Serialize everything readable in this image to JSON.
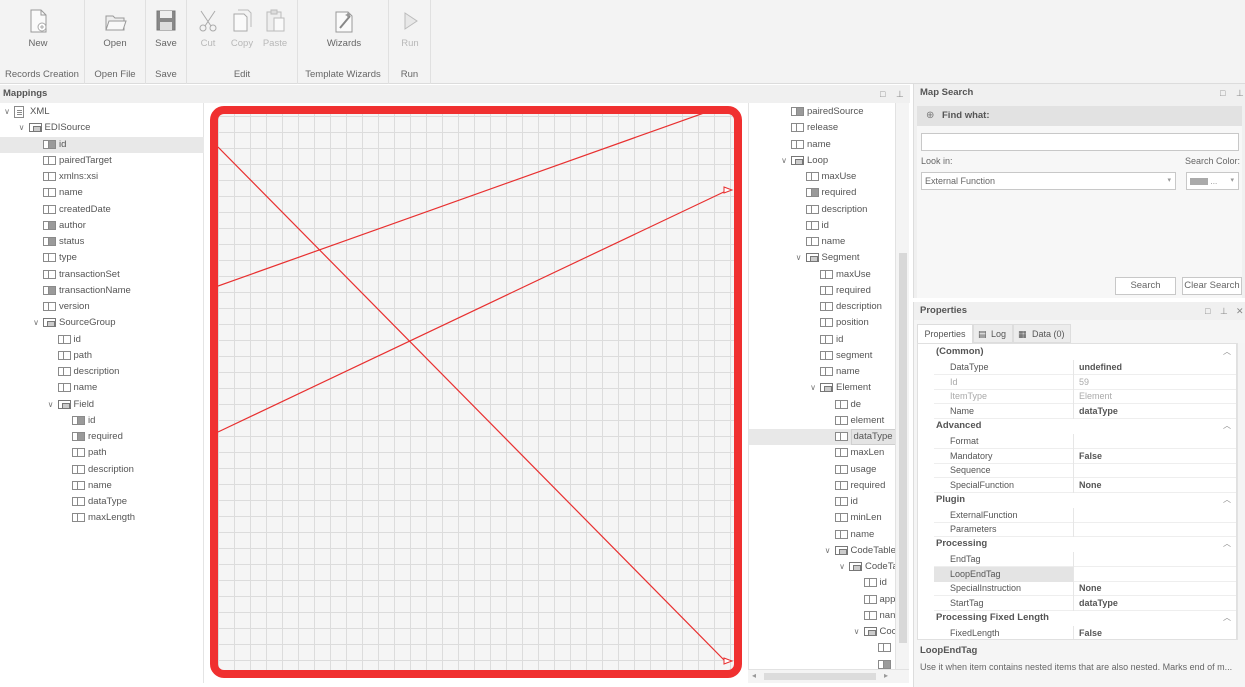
{
  "ribbon": {
    "new": "New",
    "open": "Open",
    "save": "Save",
    "cut": "Cut",
    "copy": "Copy",
    "paste": "Paste",
    "wizards": "Wizards",
    "run": "Run",
    "groups": {
      "records_creation": "Records Creation",
      "open_file": "Open File",
      "save": "Save",
      "edit": "Edit",
      "template_wizards": "Template Wizards",
      "run": "Run"
    }
  },
  "mappings": {
    "title": "Mappings",
    "tree": [
      {
        "label": "XML",
        "icon": "doc",
        "chev": "v",
        "depth": 0
      },
      {
        "label": "EDISource",
        "icon": "group",
        "chev": "v",
        "depth": 1
      },
      {
        "label": "id",
        "icon": "filled",
        "depth": 2,
        "selected": true
      },
      {
        "label": "pairedTarget",
        "icon": "field",
        "depth": 2
      },
      {
        "label": "xmlns:xsi",
        "icon": "field",
        "depth": 2
      },
      {
        "label": "name",
        "icon": "field",
        "depth": 2
      },
      {
        "label": "createdDate",
        "icon": "field",
        "depth": 2
      },
      {
        "label": "author",
        "icon": "filled",
        "depth": 2
      },
      {
        "label": "status",
        "icon": "filled",
        "depth": 2
      },
      {
        "label": "type",
        "icon": "field",
        "depth": 2
      },
      {
        "label": "transactionSet",
        "icon": "field",
        "depth": 2
      },
      {
        "label": "transactionName",
        "icon": "filled",
        "depth": 2
      },
      {
        "label": "version",
        "icon": "field",
        "depth": 2
      },
      {
        "label": "SourceGroup",
        "icon": "group",
        "chev": "v",
        "depth": 2
      },
      {
        "label": "id",
        "icon": "field",
        "depth": 3
      },
      {
        "label": "path",
        "icon": "field",
        "depth": 3
      },
      {
        "label": "description",
        "icon": "field",
        "depth": 3
      },
      {
        "label": "name",
        "icon": "field",
        "depth": 3
      },
      {
        "label": "Field",
        "icon": "group",
        "chev": "v",
        "depth": 3
      },
      {
        "label": "id",
        "icon": "filled",
        "depth": 4
      },
      {
        "label": "required",
        "icon": "filled",
        "depth": 4
      },
      {
        "label": "path",
        "icon": "field",
        "depth": 4
      },
      {
        "label": "description",
        "icon": "field",
        "depth": 4
      },
      {
        "label": "name",
        "icon": "field",
        "depth": 4
      },
      {
        "label": "dataType",
        "icon": "field",
        "depth": 4
      },
      {
        "label": "maxLength",
        "icon": "field",
        "depth": 4
      }
    ]
  },
  "target_tree": [
    {
      "label": "pairedSource",
      "icon": "filled",
      "depth": 0
    },
    {
      "label": "release",
      "icon": "field",
      "depth": 0
    },
    {
      "label": "name",
      "icon": "field",
      "depth": 0
    },
    {
      "label": "Loop",
      "icon": "group",
      "chev": "v",
      "depth": 0
    },
    {
      "label": "maxUse",
      "icon": "field",
      "depth": 1
    },
    {
      "label": "required",
      "icon": "filled",
      "depth": 1
    },
    {
      "label": "description",
      "icon": "field",
      "depth": 1
    },
    {
      "label": "id",
      "icon": "field",
      "depth": 1
    },
    {
      "label": "name",
      "icon": "field",
      "depth": 1
    },
    {
      "label": "Segment",
      "icon": "group",
      "chev": "v",
      "depth": 1
    },
    {
      "label": "maxUse",
      "icon": "field",
      "depth": 2
    },
    {
      "label": "required",
      "icon": "field",
      "depth": 2
    },
    {
      "label": "description",
      "icon": "field",
      "depth": 2
    },
    {
      "label": "position",
      "icon": "field",
      "depth": 2
    },
    {
      "label": "id",
      "icon": "field",
      "depth": 2
    },
    {
      "label": "segment",
      "icon": "field",
      "depth": 2
    },
    {
      "label": "name",
      "icon": "field",
      "depth": 2
    },
    {
      "label": "Element",
      "icon": "group",
      "chev": "v",
      "depth": 2
    },
    {
      "label": "de",
      "icon": "field",
      "depth": 3
    },
    {
      "label": "element",
      "icon": "field",
      "depth": 3
    },
    {
      "label": "dataType",
      "icon": "field",
      "depth": 3,
      "selected": true
    },
    {
      "label": "maxLen",
      "icon": "field",
      "depth": 3
    },
    {
      "label": "usage",
      "icon": "field",
      "depth": 3
    },
    {
      "label": "required",
      "icon": "field",
      "depth": 3
    },
    {
      "label": "id",
      "icon": "field",
      "depth": 3
    },
    {
      "label": "minLen",
      "icon": "field",
      "depth": 3
    },
    {
      "label": "name",
      "icon": "field",
      "depth": 3
    },
    {
      "label": "CodeTables",
      "icon": "group",
      "chev": "v",
      "depth": 3
    },
    {
      "label": "CodeTa",
      "icon": "group",
      "chev": "v",
      "depth": 4
    },
    {
      "label": "id",
      "icon": "field",
      "depth": 5
    },
    {
      "label": "app",
      "icon": "field",
      "depth": 5
    },
    {
      "label": "nan",
      "icon": "field",
      "depth": 5
    },
    {
      "label": "Coc",
      "icon": "group",
      "chev": "v",
      "depth": 5
    },
    {
      "label": "",
      "icon": "field",
      "depth": 6
    },
    {
      "label": "",
      "icon": "filled",
      "depth": 6
    }
  ],
  "map_search": {
    "title": "Map Search",
    "find_what": "Find what:",
    "find_value": "",
    "look_in_label": "Look in:",
    "look_in_value": "External Function",
    "search_color_label": "Search Color:",
    "search_color_value": "...",
    "search_button": "Search",
    "clear_search_button": "Clear Search"
  },
  "properties": {
    "title": "Properties",
    "tabs": [
      "Properties",
      "Log",
      "Data (0)"
    ],
    "categories": [
      {
        "name": "(Common)",
        "rows": [
          {
            "name": "DataType",
            "value": "undefined"
          },
          {
            "name": "Id",
            "value": "59",
            "dim": true
          },
          {
            "name": "ItemType",
            "value": "Element",
            "dim": true
          },
          {
            "name": "Name",
            "value": "dataType"
          }
        ]
      },
      {
        "name": "Advanced",
        "rows": [
          {
            "name": "Format",
            "value": ""
          },
          {
            "name": "Mandatory",
            "value": "False"
          },
          {
            "name": "Sequence",
            "value": ""
          },
          {
            "name": "SpecialFunction",
            "value": "None"
          }
        ]
      },
      {
        "name": "Plugin",
        "rows": [
          {
            "name": "ExternalFunction",
            "value": ""
          },
          {
            "name": "Parameters",
            "value": ""
          }
        ]
      },
      {
        "name": "Processing",
        "rows": [
          {
            "name": "EndTag",
            "value": ""
          },
          {
            "name": "LoopEndTag",
            "value": "",
            "selected": true
          },
          {
            "name": "SpecialInstruction",
            "value": "None"
          },
          {
            "name": "StartTag",
            "value": "dataType"
          }
        ]
      },
      {
        "name": "Processing Fixed Length",
        "rows": [
          {
            "name": "FixedLength",
            "value": "False"
          }
        ]
      }
    ],
    "help_title": "LoopEndTag",
    "help_text": "Use it when item contains nested items that are also nested. Marks end of m..."
  },
  "colors": {
    "accent_red": "#f03030",
    "mapping_line": "#e83030"
  }
}
